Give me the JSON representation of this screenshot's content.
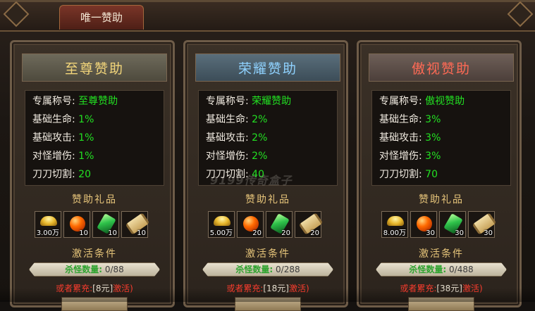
{
  "window": {
    "title": "唯一赞助"
  },
  "cards": [
    {
      "name": "至尊赞助",
      "rows": [
        {
          "label": "专属称号:",
          "value": "至尊赞助"
        },
        {
          "label": "基础生命:",
          "value": "1%"
        },
        {
          "label": "基础攻击:",
          "value": "1%"
        },
        {
          "label": "对怪增伤:",
          "value": "1%"
        },
        {
          "label": "刀刀切割:",
          "value": "20"
        }
      ],
      "gift_title": "赞助礼品",
      "gifts": [
        {
          "icon": "gold-ingot-icon",
          "count": "3.00万"
        },
        {
          "icon": "fire-orb-icon",
          "count": "10"
        },
        {
          "icon": "jade-crystal-icon",
          "count": "10"
        },
        {
          "icon": "scroll-icon",
          "count": "10"
        }
      ],
      "condition_title": "激活条件",
      "kill_label": "杀怪数量:",
      "kill_value": "0/88",
      "kill_progress": 0,
      "alt_prefix": "或者累充:",
      "alt_amount": "[8元]",
      "alt_suffix": "激活)"
    },
    {
      "name": "荣耀赞助",
      "rows": [
        {
          "label": "专属称号:",
          "value": "荣耀赞助"
        },
        {
          "label": "基础生命:",
          "value": "2%"
        },
        {
          "label": "基础攻击:",
          "value": "2%"
        },
        {
          "label": "对怪增伤:",
          "value": "2%"
        },
        {
          "label": "刀刀切割:",
          "value": "40"
        }
      ],
      "gift_title": "赞助礼品",
      "gifts": [
        {
          "icon": "gold-ingot-icon",
          "count": "5.00万"
        },
        {
          "icon": "fire-orb-icon",
          "count": "20"
        },
        {
          "icon": "jade-crystal-icon",
          "count": "20"
        },
        {
          "icon": "scroll-icon",
          "count": "20"
        }
      ],
      "condition_title": "激活条件",
      "kill_label": "杀怪数量:",
      "kill_value": "0/288",
      "kill_progress": 0,
      "alt_prefix": "或者累充:",
      "alt_amount": "[18元]",
      "alt_suffix": "激活)"
    },
    {
      "name": "傲视赞助",
      "rows": [
        {
          "label": "专属称号:",
          "value": "傲视赞助"
        },
        {
          "label": "基础生命:",
          "value": "3%"
        },
        {
          "label": "基础攻击:",
          "value": "3%"
        },
        {
          "label": "对怪增伤:",
          "value": "3%"
        },
        {
          "label": "刀刀切割:",
          "value": "70"
        }
      ],
      "gift_title": "赞助礼品",
      "gifts": [
        {
          "icon": "gold-ingot-icon",
          "count": "8.00万"
        },
        {
          "icon": "fire-orb-icon",
          "count": "30"
        },
        {
          "icon": "jade-crystal-icon",
          "count": "30"
        },
        {
          "icon": "scroll-icon",
          "count": "30"
        }
      ],
      "condition_title": "激活条件",
      "kill_label": "杀怪数量:",
      "kill_value": "0/488",
      "kill_progress": 0,
      "alt_prefix": "或者累充:",
      "alt_amount": "[38元]",
      "alt_suffix": "激活)"
    }
  ],
  "watermark": "9199传奇盒子",
  "colors": {
    "value_green": "#22e022",
    "gold_title": "#f2d57a",
    "blue_title": "#8fd2ff",
    "red_title": "#ff6a55",
    "alert_red": "#ff3d2e"
  }
}
